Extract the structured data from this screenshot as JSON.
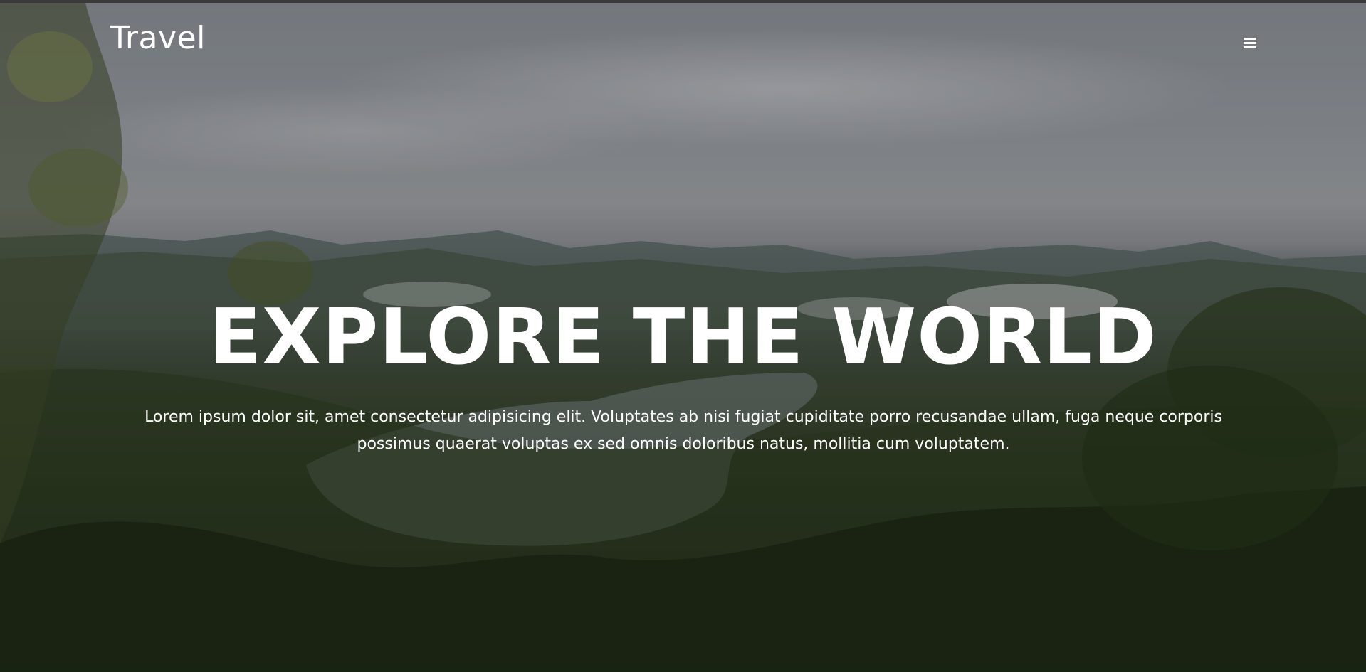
{
  "header": {
    "brand": "Travel",
    "menu_icon": "hamburger-menu-icon"
  },
  "hero": {
    "title": "EXPLORE THE WORLD",
    "description": "Lorem ipsum dolor sit, amet consectetur adipisicing elit. Voluptates ab nisi fugiat cupiditate porro recusandae ullam, fuga neque corporis possimus quaerat voluptas ex sed omnis doloribus natus, mollitia cum voluptatem."
  },
  "colors": {
    "text": "#ffffff",
    "topbar": "#3a3a3a"
  }
}
